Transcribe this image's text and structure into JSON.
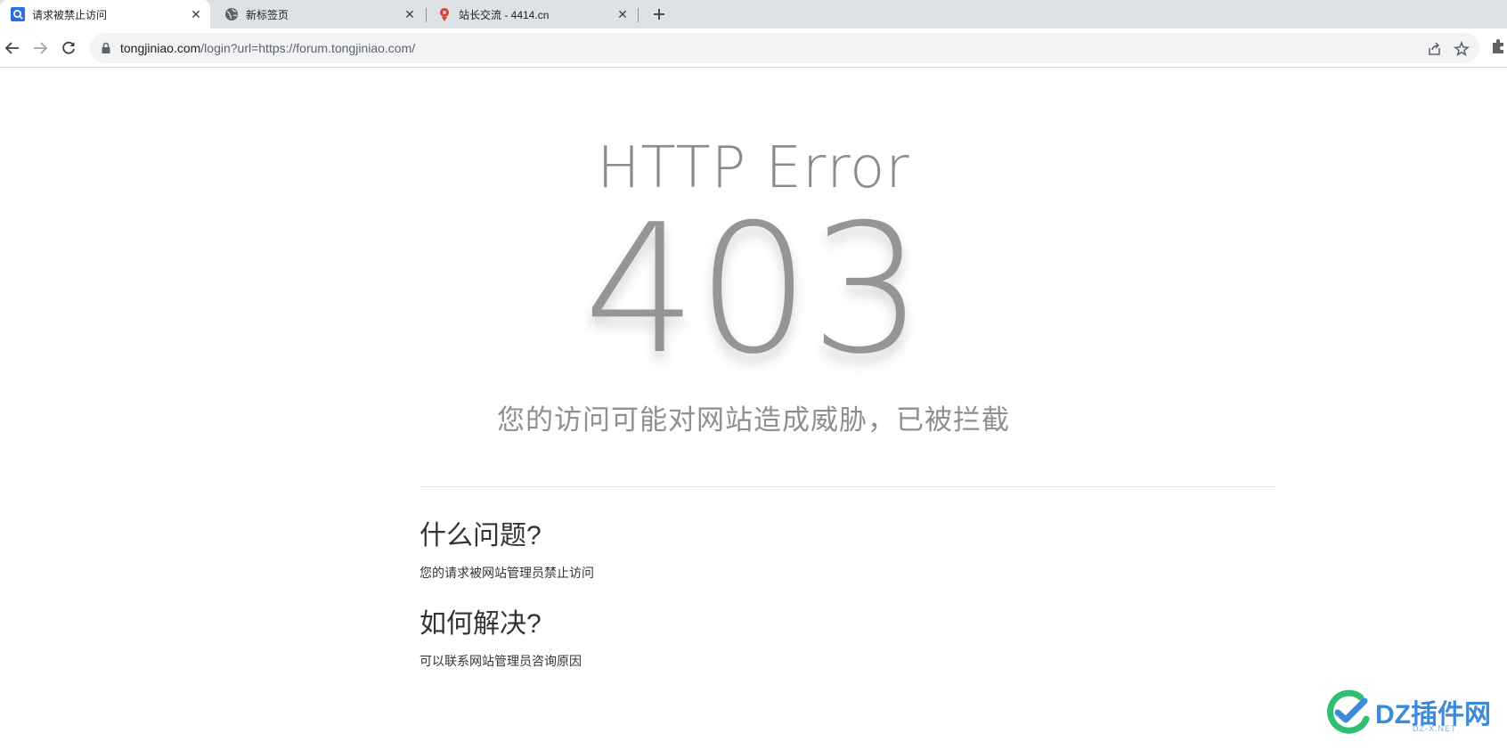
{
  "tabs": [
    {
      "title": "请求被禁止访问",
      "active": true,
      "favicon": "search-favicon-icon"
    },
    {
      "title": "新标签页",
      "active": false,
      "favicon": "globe-icon"
    },
    {
      "title": "站长交流 - 4414.cn",
      "active": false,
      "favicon": "site-favicon-icon"
    }
  ],
  "toolbar": {
    "url_host": "tongjiniao.com",
    "url_rest": "/login?url=https://forum.tongjiniao.com/"
  },
  "page": {
    "error_label": "HTTP Error",
    "status_code": "403",
    "message": "您的访问可能对网站造成威胁，已被拦截",
    "section1_title": "什么问题?",
    "section1_body": "您的请求被网站管理员禁止访问",
    "section2_title": "如何解决?",
    "section2_body": "可以联系网站管理员咨询原因"
  },
  "watermark": {
    "text": "DZ插件网",
    "sub": "DZ-X.NET"
  },
  "colors": {
    "tab_strip": "#dee1e6",
    "omnibox": "#f1f3f4",
    "error_text": "#959595",
    "heading_text": "#333333",
    "watermark_blue": "#3d8ad9"
  }
}
